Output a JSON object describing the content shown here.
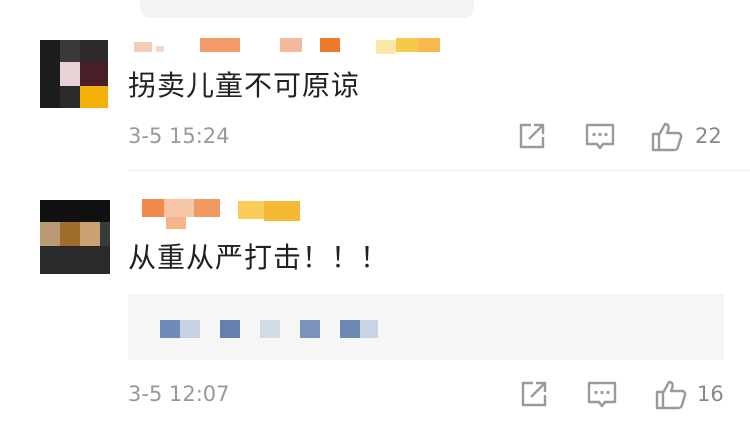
{
  "colors": {
    "text": "#222222",
    "meta": "#999999",
    "icon": "#9a9a9a",
    "divider": "#ececec",
    "quote_bg": "#f6f6f6"
  },
  "icons": {
    "share": "share-icon",
    "reply": "comment-icon",
    "like": "thumbs-up-icon"
  },
  "comments": [
    {
      "text": "拐卖儿童不可原谅",
      "time": "3-5 15:24",
      "likes": "22"
    },
    {
      "text": "从重从严打击！！！",
      "time": "3-5 12:07",
      "likes": "16"
    }
  ]
}
